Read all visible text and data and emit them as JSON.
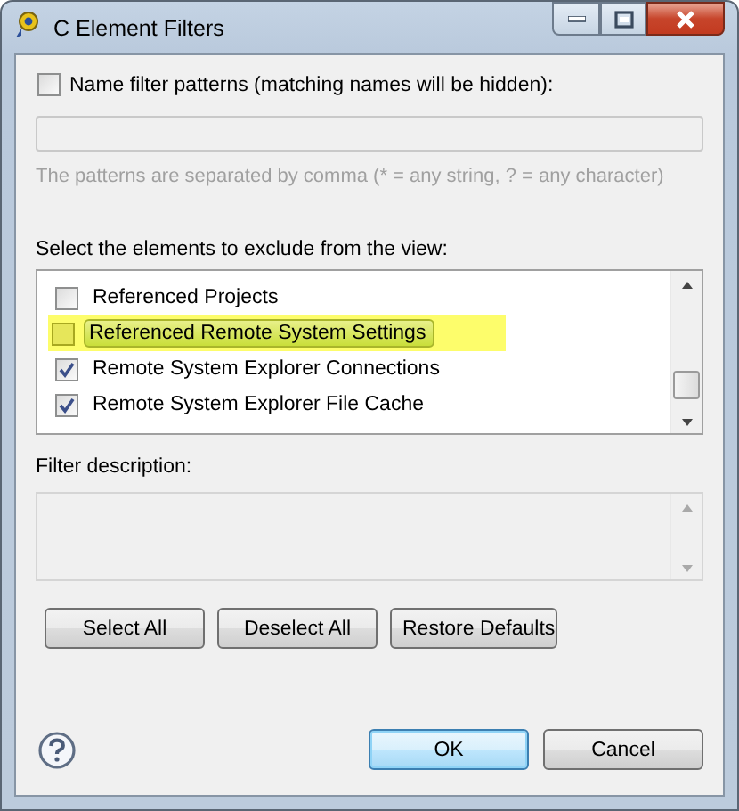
{
  "window": {
    "title": "C Element Filters"
  },
  "name_filter": {
    "label": "Name filter patterns (matching names will be hidden):",
    "checked": false,
    "hint": "The patterns are separated by comma (* = any string, ? = any character)"
  },
  "elements": {
    "label": "Select the elements to exclude from the view:",
    "items": [
      {
        "label": "Referenced Projects",
        "checked": false,
        "highlighted": false
      },
      {
        "label": "Referenced Remote System Settings",
        "checked": false,
        "highlighted": true
      },
      {
        "label": "Remote System Explorer Connections",
        "checked": true,
        "highlighted": false
      },
      {
        "label": "Remote System Explorer File Cache",
        "checked": true,
        "highlighted": false
      }
    ]
  },
  "description": {
    "label": "Filter description:"
  },
  "buttons": [
    "Select All",
    "Deselect All",
    "Restore Defaults"
  ],
  "footer_buttons": [
    {
      "label": "OK",
      "default": true
    },
    {
      "label": "Cancel",
      "default": false
    }
  ]
}
